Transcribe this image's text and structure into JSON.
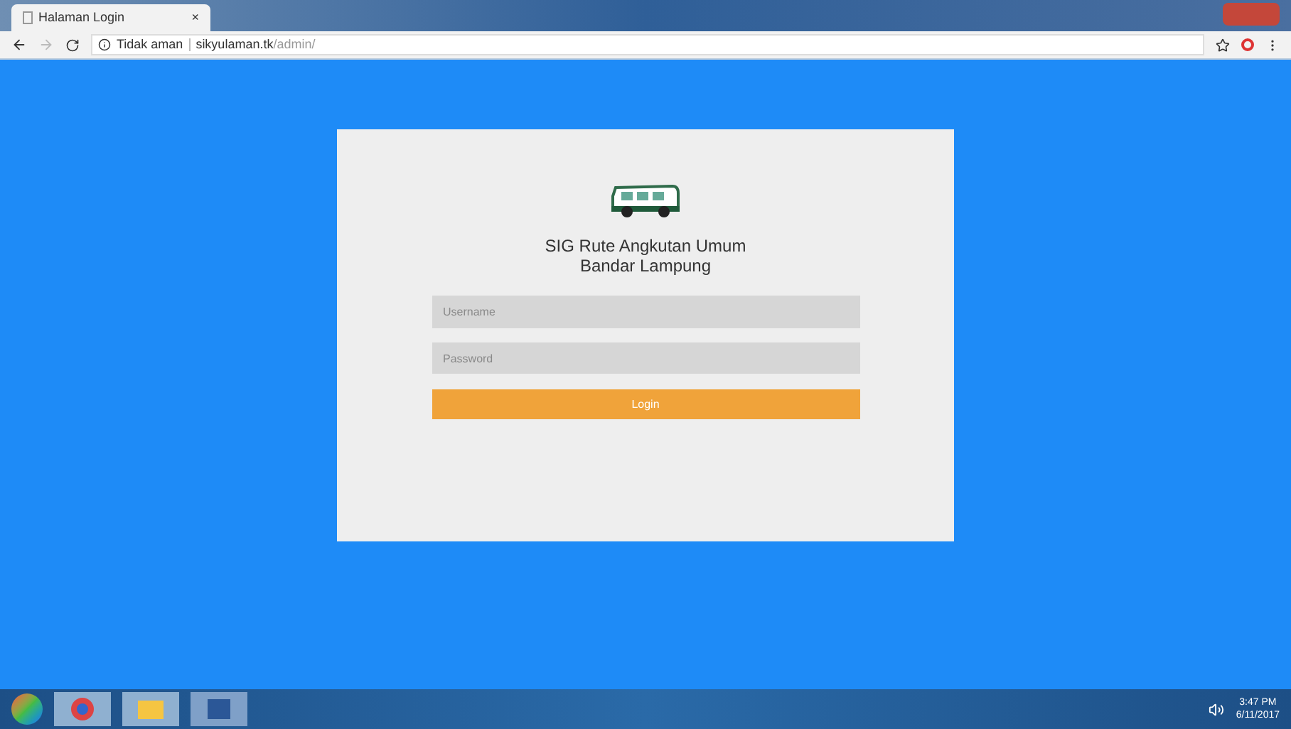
{
  "browser": {
    "tab_title": "Halaman Login",
    "tab_close": "×",
    "security": "Tidak aman",
    "url": "sikyulaman.tk",
    "url_path": "/admin/"
  },
  "login": {
    "title_line_1": "SIG Rute Angkutan Umum",
    "title_line_2": "Bandar Lampung",
    "username": {
      "placeholder": "Username"
    },
    "password": {
      "placeholder": "Password"
    },
    "button": "Login"
  },
  "taskbar": {
    "time": "3:47 PM",
    "date": "6/11/2017"
  }
}
